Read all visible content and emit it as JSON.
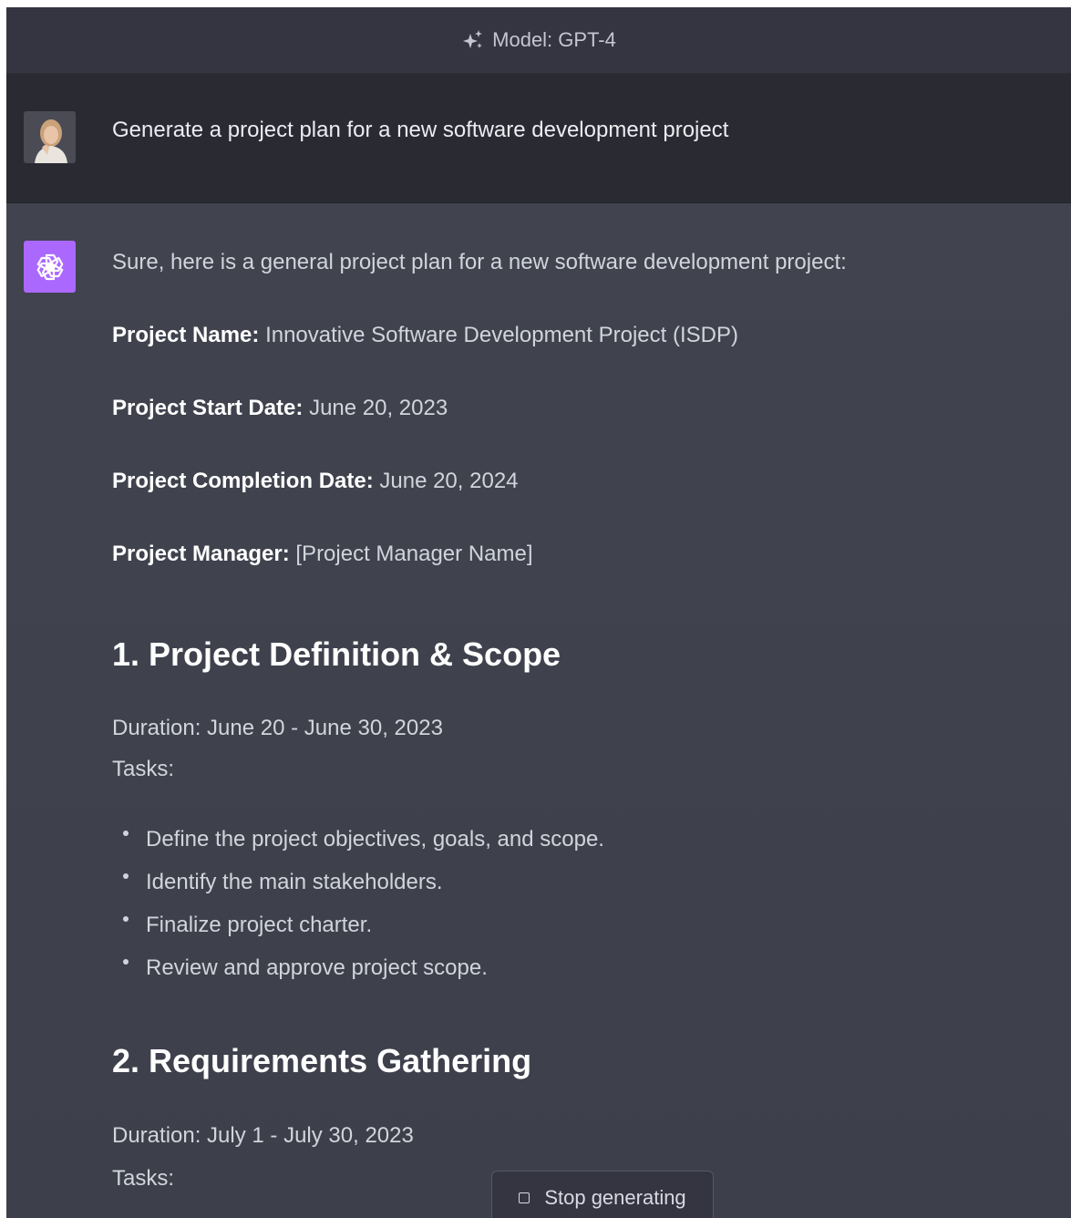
{
  "header": {
    "model_label": "Model: GPT-4",
    "icon": "sparkle-icon"
  },
  "user_message": {
    "avatar": "user-avatar",
    "text": "Generate a project plan for a new software development project"
  },
  "assistant_message": {
    "avatar": "openai-logo-icon",
    "intro": "Sure, here is a general project plan for a new software development project:",
    "fields": [
      {
        "label": "Project Name:",
        "value": "Innovative Software Development Project (ISDP)"
      },
      {
        "label": "Project Start Date:",
        "value": "June 20, 2023"
      },
      {
        "label": "Project Completion Date:",
        "value": "June 20, 2024"
      },
      {
        "label": "Project Manager:",
        "value": "[Project Manager Name]"
      }
    ],
    "sections": [
      {
        "heading": "1. Project Definition & Scope",
        "duration": "Duration: June 20 - June 30, 2023",
        "tasks_label": "Tasks:",
        "tasks": [
          "Define the project objectives, goals, and scope.",
          "Identify the main stakeholders.",
          "Finalize project charter.",
          "Review and approve project scope."
        ]
      },
      {
        "heading": "2. Requirements Gathering",
        "duration": "Duration: July 1 - July 30, 2023",
        "tasks_label": "Tasks:"
      }
    ]
  },
  "controls": {
    "stop_label": "Stop generating"
  },
  "colors": {
    "accent": "#ab68ff",
    "background": "#343541",
    "user_row": "#2a2b32",
    "assistant_row": "#444654"
  }
}
